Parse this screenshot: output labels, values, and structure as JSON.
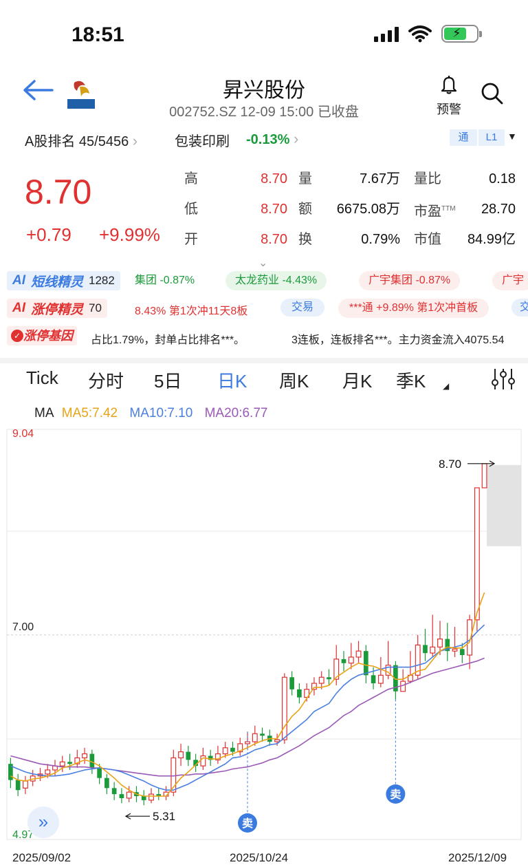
{
  "status": {
    "time": "18:51"
  },
  "header": {
    "name": "昇兴股份",
    "subtitle": "002752.SZ 12-09 15:00 已收盘",
    "alert_label": "预警"
  },
  "rank": {
    "a_share": "A股排名 45/5456",
    "sector": "包装印刷",
    "sector_change": "-0.13%",
    "badge_tong": "通",
    "badge_l1": "L1"
  },
  "quote": {
    "price": "8.70",
    "change": "+0.79",
    "change_pct": "+9.99%",
    "high_label": "高",
    "high": "8.70",
    "low_label": "低",
    "low": "8.70",
    "open_label": "开",
    "open": "8.70",
    "volume_label": "量",
    "volume": "7.67万",
    "amount_label": "额",
    "amount": "6675.08万",
    "turnover_label": "换",
    "turnover": "0.79%",
    "vol_ratio_label": "量比",
    "vol_ratio": "0.18",
    "pe_label": "市盈",
    "pe_sup": "TTM",
    "pe": "28.70",
    "mcap_label": "市值",
    "mcap": "84.99亿"
  },
  "ai_short": {
    "label": "短线精灵",
    "count": "1282",
    "items": [
      "集团 -0.87%",
      "太龙药业 -4.43%",
      "广宇集团 -0.87%",
      "广宇"
    ]
  },
  "ai_limit": {
    "label": "涨停精灵",
    "count": "70",
    "item1": "8.43% 第1次冲11天8板",
    "item1_btn": "交易",
    "item2": "***通 +9.89% 第1次冲首板",
    "item2_btn": "交"
  },
  "gene": {
    "label": "涨停基因",
    "text1": "占比1.79%，封单占比排名***。",
    "text2": "3连板，连板排名***。主力资金流入4075.54"
  },
  "tabs": [
    "Tick",
    "分时",
    "5日",
    "日K",
    "周K",
    "月K",
    "季K"
  ],
  "active_tab": "日K",
  "ma": {
    "label": "MA",
    "ma5": "MA5:7.42",
    "ma10": "MA10:7.10",
    "ma20": "MA20:6.77"
  },
  "colors": {
    "up": "#e03030",
    "down": "#1a9a3a",
    "accent": "#3b7be0",
    "ma5": "#e8a317",
    "ma10": "#4a7fe0",
    "ma20": "#9b59b6"
  },
  "chart_data": {
    "type": "candlestick",
    "y_max_label": "9.04",
    "y_mid_label": "7.00",
    "y_min_label": "4.97",
    "ylim": [
      4.97,
      9.04
    ],
    "last_price_label": "8.70",
    "low_marker_label": "5.31",
    "sell_label": "卖",
    "x_labels": [
      "2025/09/02",
      "2025/10/24",
      "2025/12/09"
    ],
    "candles": [
      [
        5.72,
        5.56,
        5.78,
        5.48
      ],
      [
        5.56,
        5.46,
        5.62,
        5.4
      ],
      [
        5.48,
        5.55,
        5.6,
        5.42
      ],
      [
        5.55,
        5.6,
        5.66,
        5.5
      ],
      [
        5.6,
        5.62,
        5.68,
        5.55
      ],
      [
        5.62,
        5.66,
        5.72,
        5.58
      ],
      [
        5.66,
        5.7,
        5.76,
        5.6
      ],
      [
        5.7,
        5.74,
        5.8,
        5.64
      ],
      [
        5.74,
        5.72,
        5.82,
        5.66
      ],
      [
        5.72,
        5.78,
        5.86,
        5.68
      ],
      [
        5.78,
        5.82,
        5.88,
        5.72
      ],
      [
        5.82,
        5.68,
        5.86,
        5.62
      ],
      [
        5.68,
        5.58,
        5.72,
        5.52
      ],
      [
        5.58,
        5.48,
        5.62,
        5.42
      ],
      [
        5.48,
        5.42,
        5.54,
        5.36
      ],
      [
        5.42,
        5.38,
        5.48,
        5.33
      ],
      [
        5.38,
        5.44,
        5.5,
        5.34
      ],
      [
        5.44,
        5.4,
        5.5,
        5.34
      ],
      [
        5.4,
        5.36,
        5.46,
        5.31
      ],
      [
        5.36,
        5.42,
        5.48,
        5.33
      ],
      [
        5.42,
        5.4,
        5.48,
        5.36
      ],
      [
        5.4,
        5.44,
        5.5,
        5.36
      ],
      [
        5.44,
        5.78,
        5.86,
        5.4
      ],
      [
        5.78,
        5.84,
        5.92,
        5.7
      ],
      [
        5.84,
        5.76,
        5.9,
        5.7
      ],
      [
        5.76,
        5.7,
        5.82,
        5.64
      ],
      [
        5.7,
        5.8,
        5.88,
        5.66
      ],
      [
        5.8,
        5.76,
        5.86,
        5.7
      ],
      [
        5.76,
        5.82,
        5.9,
        5.72
      ],
      [
        5.82,
        5.88,
        5.94,
        5.78
      ],
      [
        5.88,
        5.84,
        5.94,
        5.8
      ],
      [
        5.84,
        5.92,
        5.98,
        5.8
      ],
      [
        5.92,
        5.94,
        6.04,
        5.86
      ],
      [
        5.94,
        6.02,
        6.1,
        5.9
      ],
      [
        6.02,
        6.0,
        6.08,
        5.94
      ],
      [
        6.0,
        5.94,
        6.06,
        5.9
      ],
      [
        5.94,
        5.96,
        6.02,
        5.9
      ],
      [
        5.96,
        6.58,
        6.62,
        5.92
      ],
      [
        6.58,
        6.46,
        6.64,
        6.4
      ],
      [
        6.46,
        6.38,
        6.52,
        6.32
      ],
      [
        6.38,
        6.46,
        6.52,
        6.34
      ],
      [
        6.46,
        6.52,
        6.58,
        6.4
      ],
      [
        6.52,
        6.58,
        6.64,
        6.46
      ],
      [
        6.58,
        6.56,
        6.66,
        6.5
      ],
      [
        6.56,
        6.76,
        6.9,
        6.5
      ],
      [
        6.76,
        6.72,
        6.84,
        6.64
      ],
      [
        6.72,
        6.78,
        6.92,
        6.66
      ],
      [
        6.78,
        6.84,
        6.94,
        6.72
      ],
      [
        6.84,
        6.6,
        6.9,
        6.52
      ],
      [
        6.6,
        6.52,
        6.68,
        6.46
      ],
      [
        6.52,
        6.6,
        6.78,
        6.48
      ],
      [
        6.6,
        6.7,
        6.94,
        6.56
      ],
      [
        6.7,
        6.44,
        6.74,
        6.36
      ],
      [
        6.44,
        6.54,
        6.66,
        6.44
      ],
      [
        6.54,
        6.6,
        6.84,
        6.52
      ],
      [
        6.6,
        6.9,
        7.0,
        6.56
      ],
      [
        6.9,
        6.82,
        7.06,
        6.74
      ],
      [
        6.82,
        6.88,
        7.2,
        6.78
      ],
      [
        6.88,
        6.96,
        7.14,
        6.8
      ],
      [
        6.96,
        6.84,
        7.12,
        6.74
      ],
      [
        6.84,
        6.86,
        7.08,
        6.78
      ],
      [
        6.86,
        6.8,
        6.92,
        6.72
      ],
      [
        6.8,
        7.15,
        7.2,
        6.66
      ],
      [
        7.15,
        8.46,
        8.46,
        7.04
      ],
      [
        8.46,
        8.7,
        8.7,
        8.7
      ]
    ],
    "ma5_values": [
      5.6,
      5.56,
      5.55,
      5.57,
      5.58,
      5.6,
      5.63,
      5.68,
      5.7,
      5.73,
      5.76,
      5.74,
      5.7,
      5.64,
      5.58,
      5.51,
      5.46,
      5.42,
      5.4,
      5.4,
      5.4,
      5.4,
      5.49,
      5.58,
      5.64,
      5.71,
      5.78,
      5.77,
      5.77,
      5.8,
      5.82,
      5.85,
      5.88,
      5.92,
      5.95,
      5.97,
      5.97,
      6.09,
      6.19,
      6.26,
      6.37,
      6.48,
      6.48,
      6.5,
      6.58,
      6.63,
      6.68,
      6.72,
      6.7,
      6.69,
      6.66,
      6.63,
      6.56,
      6.56,
      6.6,
      6.64,
      6.66,
      6.75,
      6.84,
      6.88,
      6.87,
      6.87,
      6.93,
      7.22,
      7.42
    ],
    "ma10_values": [
      5.7,
      5.67,
      5.64,
      5.62,
      5.61,
      5.6,
      5.6,
      5.61,
      5.62,
      5.64,
      5.66,
      5.67,
      5.68,
      5.67,
      5.66,
      5.64,
      5.61,
      5.58,
      5.55,
      5.51,
      5.48,
      5.46,
      5.46,
      5.49,
      5.52,
      5.56,
      5.6,
      5.64,
      5.68,
      5.72,
      5.78,
      5.79,
      5.82,
      5.86,
      5.88,
      5.91,
      5.92,
      5.98,
      6.04,
      6.1,
      6.16,
      6.24,
      6.28,
      6.32,
      6.42,
      6.5,
      6.56,
      6.6,
      6.62,
      6.64,
      6.66,
      6.68,
      6.68,
      6.68,
      6.68,
      6.7,
      6.72,
      6.78,
      6.84,
      6.86,
      6.88,
      6.9,
      6.95,
      7.03,
      7.1
    ],
    "ma20_values": [
      5.8,
      5.78,
      5.76,
      5.74,
      5.72,
      5.71,
      5.7,
      5.69,
      5.69,
      5.69,
      5.69,
      5.68,
      5.68,
      5.67,
      5.66,
      5.65,
      5.64,
      5.63,
      5.62,
      5.61,
      5.6,
      5.6,
      5.6,
      5.61,
      5.61,
      5.62,
      5.62,
      5.63,
      5.64,
      5.65,
      5.67,
      5.68,
      5.69,
      5.71,
      5.73,
      5.76,
      5.78,
      5.82,
      5.86,
      5.9,
      5.95,
      6.0,
      6.04,
      6.08,
      6.14,
      6.2,
      6.24,
      6.3,
      6.34,
      6.38,
      6.42,
      6.46,
      6.48,
      6.5,
      6.53,
      6.56,
      6.59,
      6.62,
      6.64,
      6.66,
      6.68,
      6.7,
      6.72,
      6.74,
      6.77
    ]
  }
}
